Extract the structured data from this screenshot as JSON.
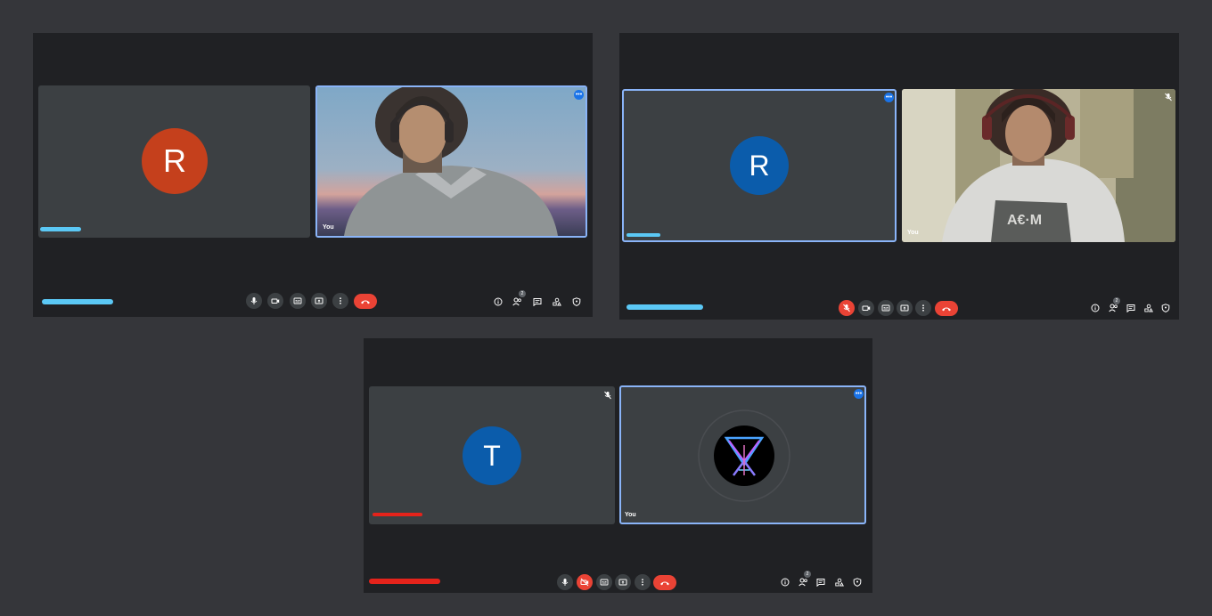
{
  "colors": {
    "page_bg": "#35363a",
    "window_bg": "#202124",
    "tile_bg": "#3c4043",
    "active_border": "#8ab4f8",
    "avatar_orange": "#c5401c",
    "avatar_blue": "#0b5cab",
    "hangup_red": "#ea4335",
    "name_blur_blue": "#5bc8f5",
    "name_blur_red": "#e5231b"
  },
  "windows": [
    {
      "participant": {
        "initial": "R",
        "avatar_color": "#c5401c",
        "muted": false
      },
      "self": {
        "label": "You",
        "video": "camera-feed"
      },
      "toolbar": {
        "mic_muted": false,
        "camera_off": false,
        "participants_count": "2"
      }
    },
    {
      "participant": {
        "initial": "R",
        "avatar_color": "#0b5cab",
        "muted": false
      },
      "self": {
        "label": "You",
        "video": "camera-feed"
      },
      "toolbar": {
        "mic_muted": true,
        "camera_off": false,
        "participants_count": "2"
      }
    },
    {
      "participant": {
        "initial": "T",
        "avatar_color": "#0b5cab",
        "muted": true
      },
      "self": {
        "label": "You",
        "video": "profile-logo"
      },
      "toolbar": {
        "mic_muted": false,
        "camera_off": true,
        "participants_count": "2"
      }
    }
  ]
}
